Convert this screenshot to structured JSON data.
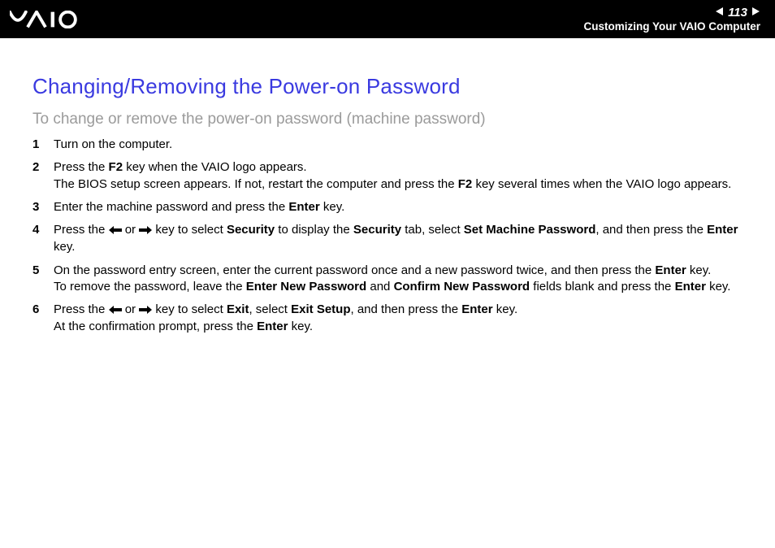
{
  "header": {
    "page_number": "113",
    "section_title": "Customizing Your VAIO Computer"
  },
  "title": "Changing/Removing the Power-on Password",
  "subtitle": "To change or remove the power-on password (machine password)",
  "steps": {
    "s1": "Turn on the computer.",
    "s2": {
      "pre": "Press the ",
      "k1": "F2",
      "mid1": " key when the VAIO logo appears.",
      "line2a": "The BIOS setup screen appears. If not, restart the computer and press the ",
      "k2": "F2",
      "line2b": " key several times when the VAIO logo appears."
    },
    "s3": {
      "pre": "Enter the machine password and press the ",
      "k1": "Enter",
      "post": " key."
    },
    "s4": {
      "a": "Press the ",
      "b": " or ",
      "c": " key to select ",
      "k1": "Security",
      "d": " to display the ",
      "k2": "Security",
      "e": " tab, select ",
      "k3": "Set Machine Password",
      "f": ", and then press the ",
      "k4": "Enter",
      "g": " key."
    },
    "s5": {
      "a": "On the password entry screen, enter the current password once and a new password twice, and then press the ",
      "k1": "Enter",
      "b": " key.",
      "c": "To remove the password, leave the ",
      "k2": "Enter New Password",
      "d": " and ",
      "k3": "Confirm New Password",
      "e": " fields blank and press the ",
      "k4": "Enter",
      "f": " key."
    },
    "s6": {
      "a": "Press the ",
      "b": " or ",
      "c": " key to select ",
      "k1": "Exit",
      "d": ", select ",
      "k2": "Exit Setup",
      "e": ", and then press the ",
      "k3": "Enter",
      "f": " key.",
      "g": "At the confirmation prompt, press the ",
      "k4": "Enter",
      "h": " key."
    }
  }
}
